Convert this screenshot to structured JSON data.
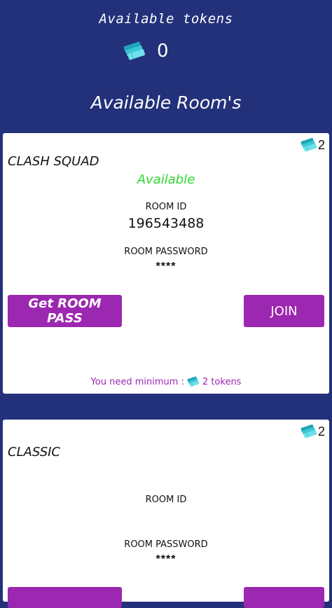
{
  "header": {
    "tokens_title": "Available tokens",
    "token_count": "0",
    "rooms_title": "Available Room's"
  },
  "rooms": [
    {
      "cost": "2",
      "mode": "CLASH SQUAD",
      "status": "Available",
      "room_id_label": "ROOM ID",
      "room_id": "196543488",
      "password_label": "ROOM PASSWORD",
      "password": "****",
      "pass_button": "Get ROOM PASS",
      "join_button": "JOIN",
      "min_prefix": "You need minimum :",
      "min_suffix": "2 tokens"
    },
    {
      "cost": "2",
      "mode": "CLASSIC",
      "room_id_label": "ROOM ID",
      "password_label": "ROOM PASSWORD",
      "password": "****"
    }
  ],
  "icons": {
    "token": "ticket-icon"
  },
  "colors": {
    "background": "#23317a",
    "accent": "#9c27b0",
    "available": "#2fd62f",
    "ticket": "#3cc7d6"
  }
}
